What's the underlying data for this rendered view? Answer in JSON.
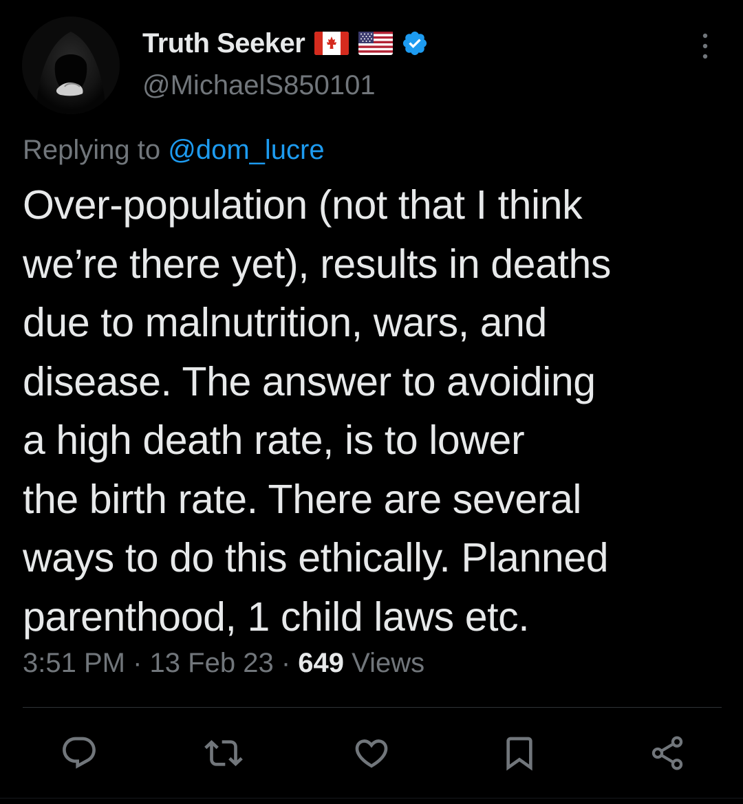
{
  "author": {
    "display_name": "Truth Seeker",
    "handle": "@MichaelS850101",
    "flags": [
      "canada-flag-icon",
      "us-flag-icon"
    ],
    "verified": true
  },
  "reply": {
    "prefix": "Replying to",
    "mention": "@dom_lucre"
  },
  "tweet": {
    "text": "Over-population (not that I think\nwe’re there yet), results in deaths\ndue to malnutrition, wars, and\ndisease. The answer to avoiding\na high death rate, is to lower\nthe birth rate. There are several\nways to do this ethically. Planned\nparenthood, 1 child laws etc."
  },
  "meta": {
    "time": "3:51 PM",
    "separator": "·",
    "date": "13 Feb 23",
    "views_count": "649",
    "views_label": "Views"
  },
  "actions": [
    {
      "icon": "reply-icon"
    },
    {
      "icon": "retweet-icon"
    },
    {
      "icon": "like-icon"
    },
    {
      "icon": "bookmark-icon"
    },
    {
      "icon": "share-icon"
    }
  ],
  "colors": {
    "background": "#000000",
    "text_primary": "#e7e9ea",
    "text_secondary": "#71767b",
    "link": "#1d9bf0",
    "verified": "#1d9bf0",
    "divider": "#2f3336"
  }
}
